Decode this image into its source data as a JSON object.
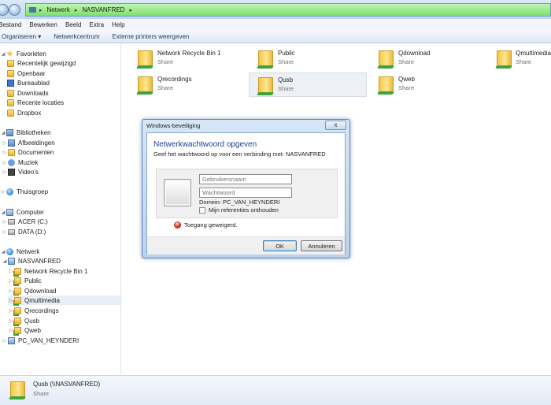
{
  "address": {
    "crumbs": [
      "Netwerk",
      "NASVANFRED"
    ]
  },
  "menu": [
    "Bestand",
    "Bewerken",
    "Beeld",
    "Extra",
    "Help"
  ],
  "commands": [
    "Organiseren ▾",
    "Netwerkcentrum",
    "Externe printers weergeven"
  ],
  "sidebar": {
    "favorites_label": "Favorieten",
    "favorites": [
      "Recentelijk gewijzigd",
      "Openbaar",
      "Bureaublad",
      "Downloads",
      "Recente locaties",
      "Dropbox"
    ],
    "libraries_label": "Bibliotheken",
    "libraries": [
      "Afbeeldingen",
      "Documenten",
      "Muziek",
      "Video's"
    ],
    "homegroup_label": "Thuisgroep",
    "computer_label": "Computer",
    "drives": [
      "ACER (C:)",
      "DATA (D:)"
    ],
    "network_label": "Netwerk",
    "nas_label": "NASVANFRED",
    "shares": [
      "Network Recycle Bin 1",
      "Public",
      "Qdownload",
      "Qmultimedia",
      "Qrecordings",
      "Qusb",
      "Qweb"
    ],
    "selected_share": "Qmultimedia",
    "pc_label": "PC_VAN_HEYNDERI"
  },
  "content": {
    "items": [
      {
        "name": "Network Recycle Bin 1",
        "sub": "Share"
      },
      {
        "name": "Public",
        "sub": "Share"
      },
      {
        "name": "Qdownload",
        "sub": "Share"
      },
      {
        "name": "Qmultimedia",
        "sub": "Share"
      },
      {
        "name": "Qrecordings",
        "sub": "Share"
      },
      {
        "name": "Qusb",
        "sub": "Share"
      },
      {
        "name": "Qweb",
        "sub": "Share"
      }
    ],
    "selected": "Qusb"
  },
  "details": {
    "name": "Qusb (\\\\NASVANFRED)",
    "sub": "Share"
  },
  "dialog": {
    "window_title": "Windows-beveiliging",
    "close_glyph": "x",
    "heading": "Netwerkwachtwoord opgeven",
    "description": "Geef het wachtwoord op voor een verbinding met: NASVANFRED",
    "username_placeholder": "Gebruikersnaam",
    "password_placeholder": "Wachtwoord",
    "domain": "Domein: PC_VAN_HEYNDERI",
    "remember_label": "Mijn referenties onthouden",
    "error_text": "Toegang geweigerd.",
    "ok_label": "OK",
    "cancel_label": "Annuleren"
  }
}
